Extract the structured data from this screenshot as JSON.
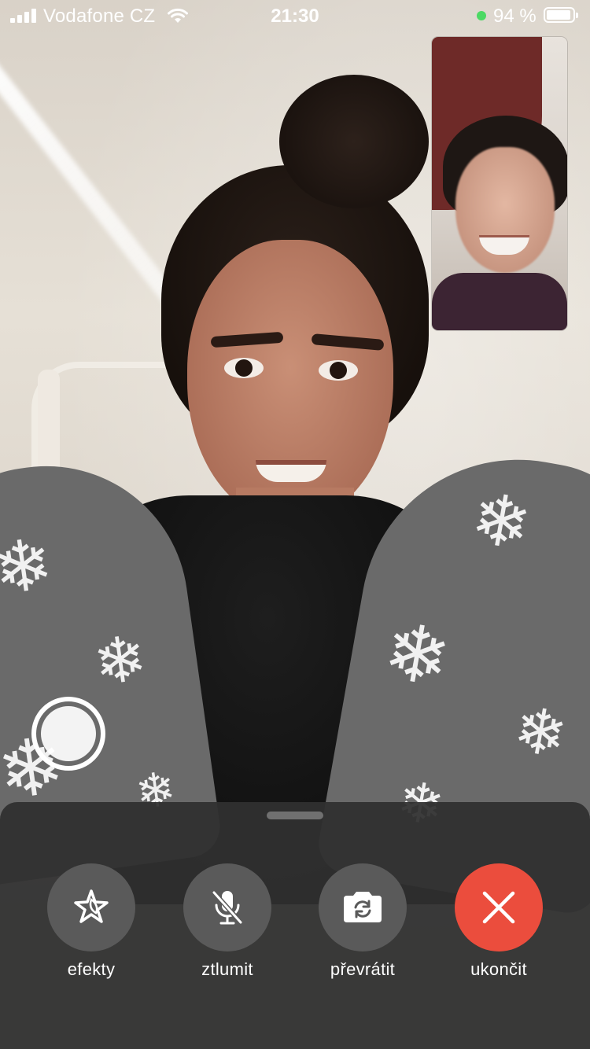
{
  "status_bar": {
    "carrier": "Vodafone CZ",
    "time": "21:30",
    "battery_percent_text": "94 %",
    "battery_level": 0.94,
    "signal_bars": 4,
    "charging_indicator_color": "#4cd964"
  },
  "record": {
    "icon": "record-icon"
  },
  "controls": {
    "effects_label": "efekty",
    "effects_icon": "effects-star-icon",
    "mute_label": "ztlumit",
    "mute_icon": "microphone-muted-icon",
    "flip_label": "převrátit",
    "flip_icon": "camera-flip-icon",
    "end_label": "ukončit",
    "end_icon": "close-x-icon",
    "end_color": "#eb4d3d"
  }
}
